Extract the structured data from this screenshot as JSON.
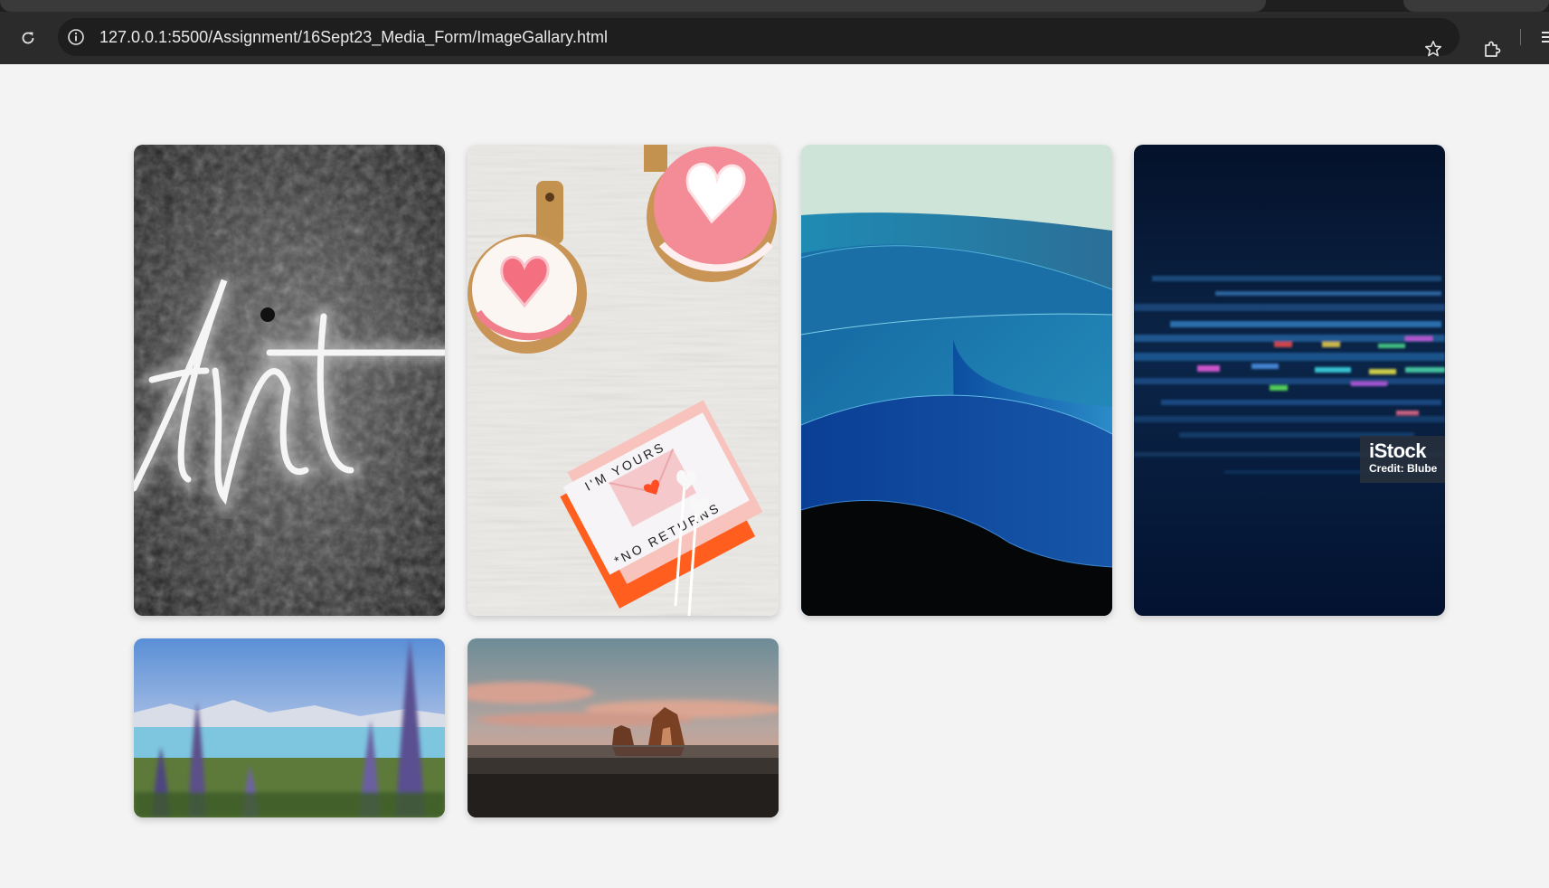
{
  "browser": {
    "url": "127.0.0.1:5500/Assignment/16Sept23_Media_Form/ImageGallary.html"
  },
  "gallery": {
    "images": [
      {
        "id": "neon-art",
        "text": "Art"
      },
      {
        "id": "cakes-valentine",
        "card_line1": "I'M YOURS",
        "card_line2": "*NO RETURNS"
      },
      {
        "id": "blue-waves"
      },
      {
        "id": "digital-glitch",
        "watermark_logo": "iStock",
        "watermark_credit": "Credit: Blube"
      },
      {
        "id": "lake-lupines"
      },
      {
        "id": "sunset-rocks"
      }
    ]
  },
  "colors": {
    "page_bg": "#f3f3f3",
    "toolbar_bg": "#2b2b2b",
    "omnibox_bg": "#1e1e1e"
  }
}
